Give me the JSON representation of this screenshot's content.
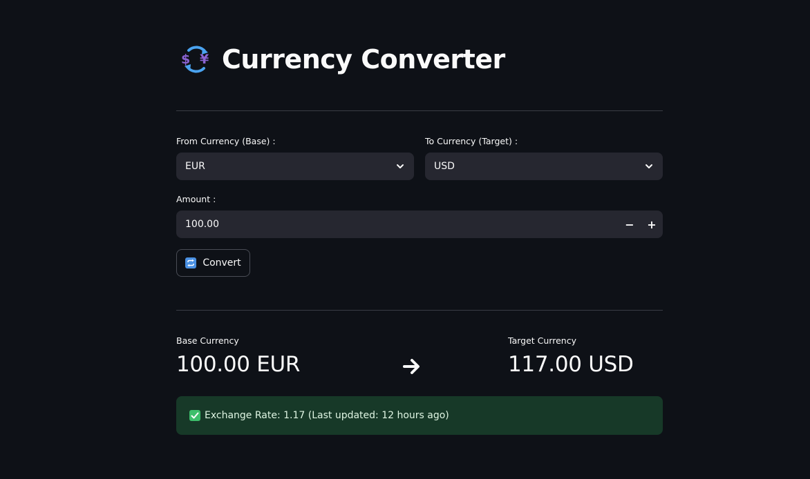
{
  "header": {
    "title": "Currency Converter",
    "icon": "currency-exchange-icon"
  },
  "form": {
    "from_label": "From Currency (Base) :",
    "from_value": "EUR",
    "to_label": "To Currency (Target) :",
    "to_value": "USD",
    "amount_label": "Amount :",
    "amount_value": "100.00",
    "decrement_label": "−",
    "increment_label": "+",
    "convert_label": "Convert"
  },
  "result": {
    "base_label": "Base Currency",
    "base_value": "100.00 EUR",
    "target_label": "Target Currency",
    "target_value": "117.00 USD",
    "message": "Exchange Rate: 1.17 (Last updated: 12 hours ago)"
  },
  "colors": {
    "background": "#0e1117",
    "input_bg": "#262730",
    "success_bg": "#173928",
    "accent_blue": "#4a90e2",
    "accent_purple": "#8a63d2",
    "check_green": "#3dbf6b"
  }
}
